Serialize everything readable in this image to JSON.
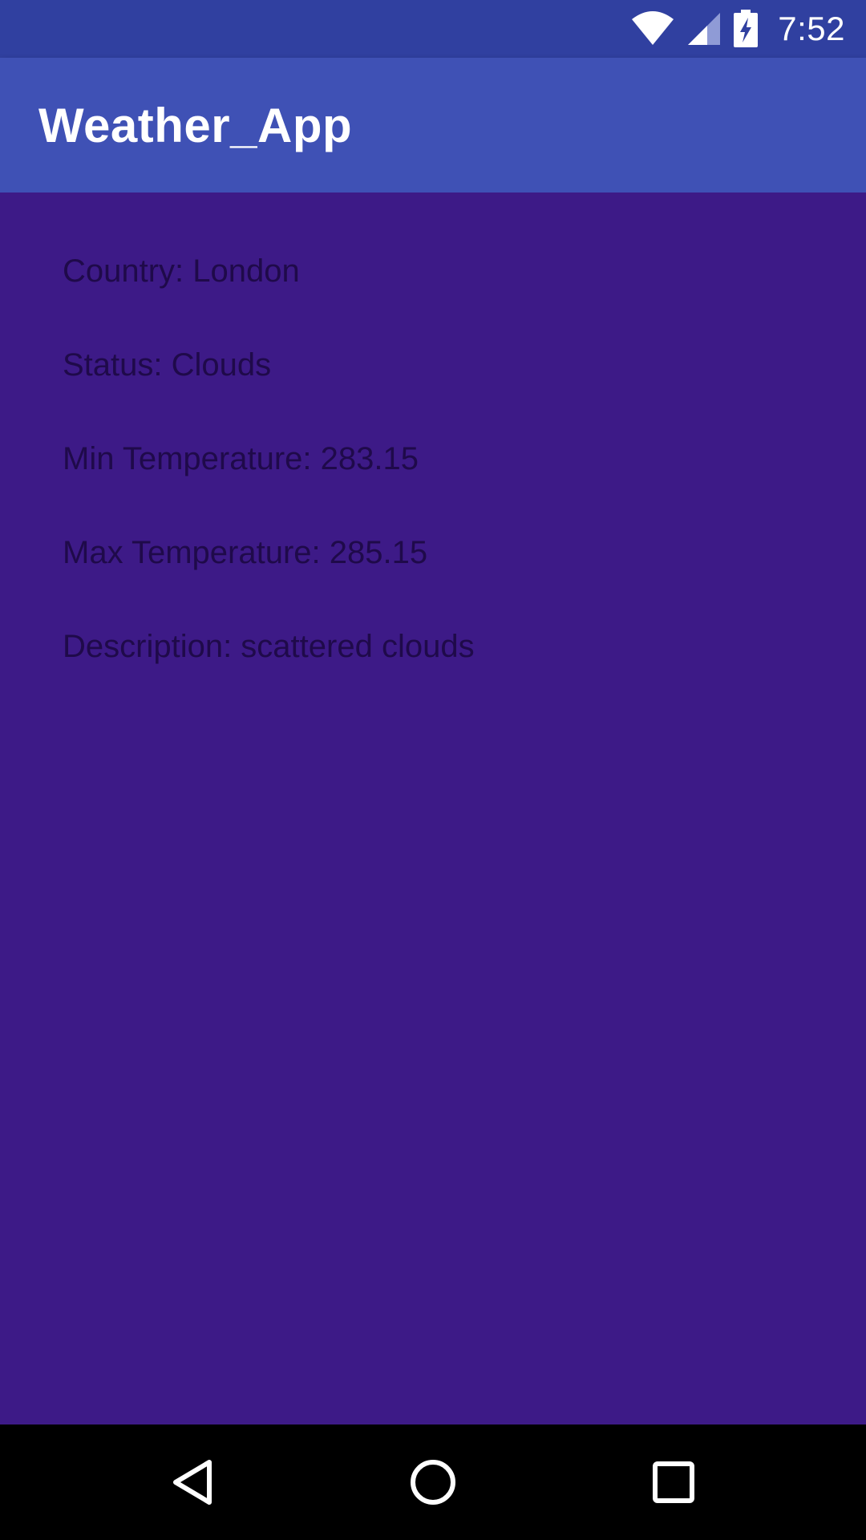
{
  "status_bar": {
    "time": "7:52",
    "icons": [
      "wifi-icon",
      "cell-signal-icon",
      "battery-charging-icon"
    ],
    "background": "#3040a0"
  },
  "app_bar": {
    "title": "Weather_App",
    "background": "#3f51b5"
  },
  "content": {
    "background": "#3d1a87",
    "text_color": "#1f0a4a",
    "lines": [
      "Country: London",
      "Status: Clouds",
      "Min Temperature: 283.15",
      "Max Temperature: 285.15",
      "Description: scattered clouds"
    ]
  },
  "nav_bar": {
    "buttons": [
      "back-icon",
      "home-icon",
      "recents-icon"
    ]
  }
}
